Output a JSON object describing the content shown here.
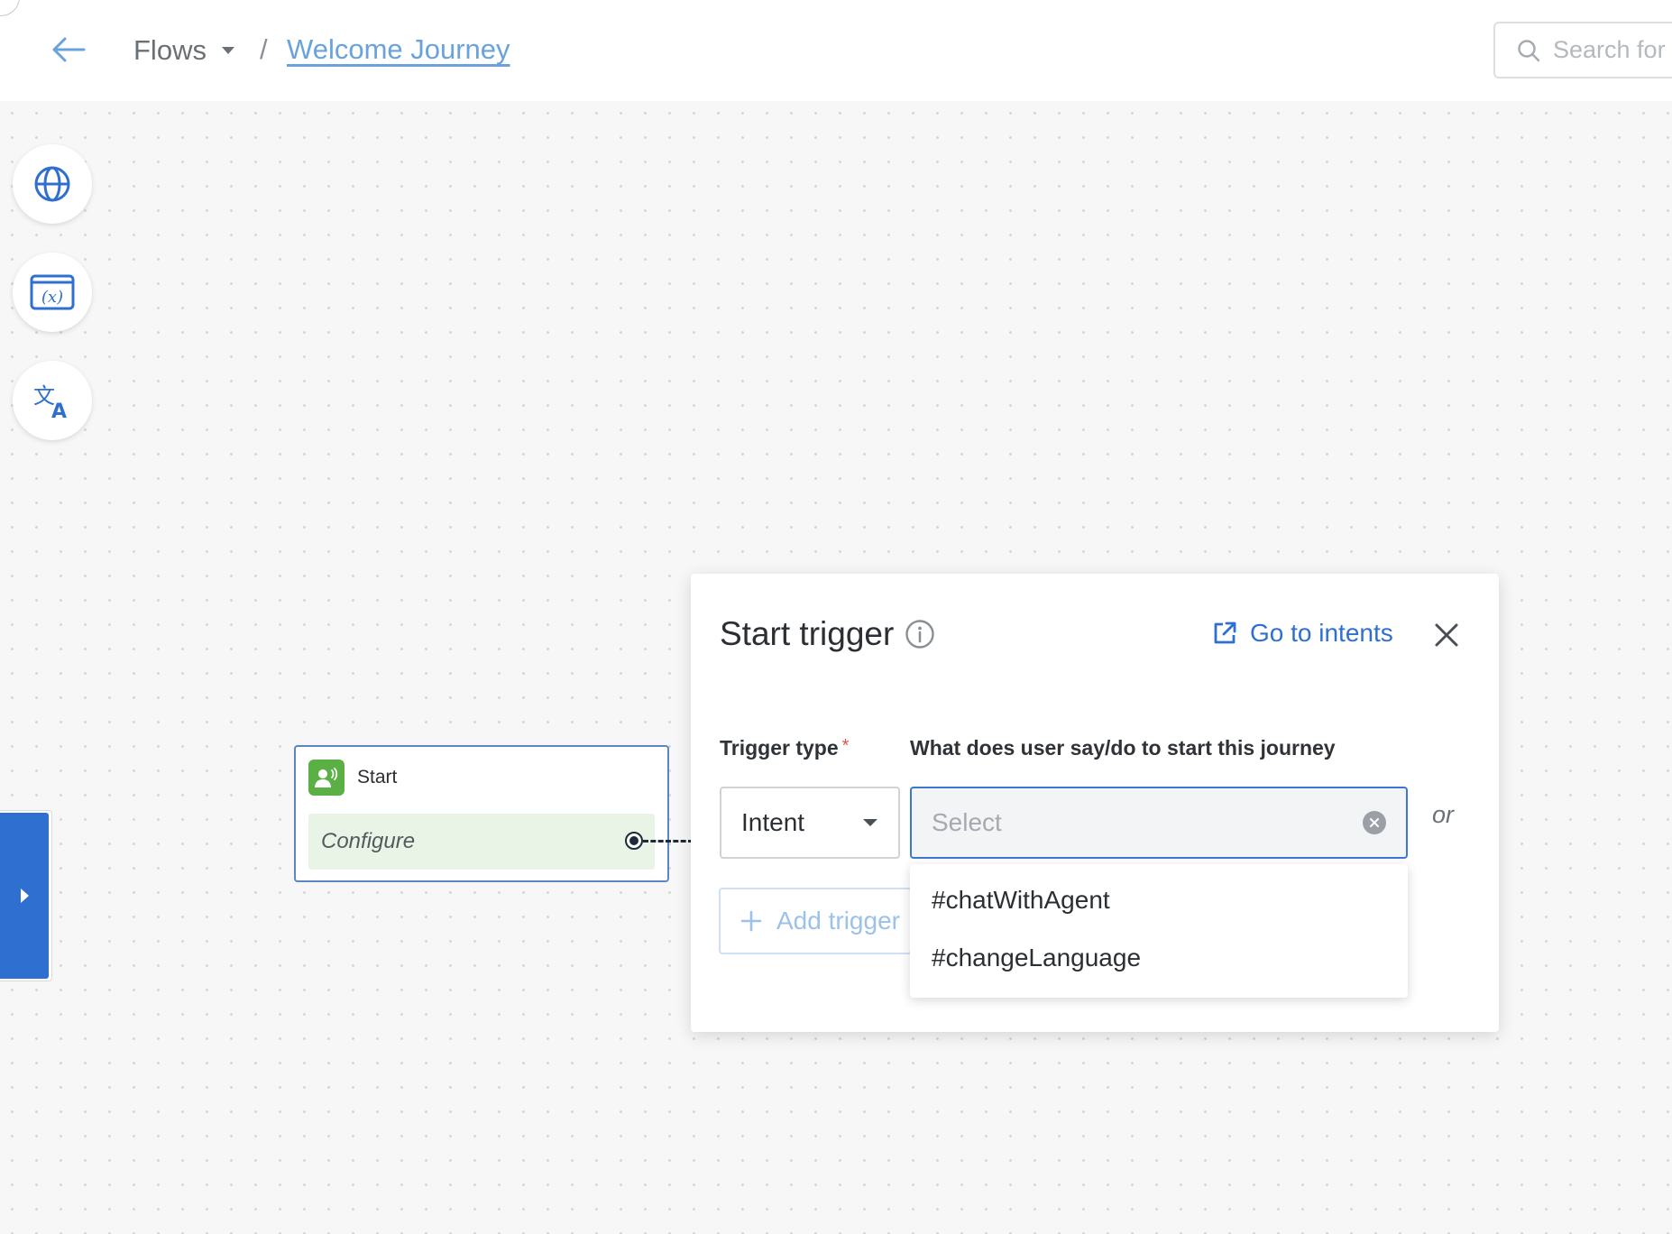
{
  "header": {
    "breadcrumb_root": "Flows",
    "breadcrumb_separator": "/",
    "breadcrumb_current": "Welcome Journey",
    "search_placeholder": "Search for"
  },
  "canvas": {
    "tools": [
      {
        "icon": "globe-icon"
      },
      {
        "icon": "variable-icon"
      },
      {
        "icon": "translate-icon"
      }
    ],
    "start_node": {
      "title": "Start",
      "configure_label": "Configure"
    }
  },
  "dialog": {
    "title": "Start trigger",
    "goto_label": "Go to intents",
    "trigger_type_label": "Trigger type",
    "required_marker": "*",
    "what_label": "What does user say/do to start this journey",
    "trigger_type_value": "Intent",
    "intent_placeholder": "Select",
    "or_label": "or",
    "add_trigger_label": "Add trigger",
    "options": [
      "#chatWithAgent",
      "#changeLanguage"
    ]
  },
  "colors": {
    "accent": "#2f6fd0",
    "link": "#6aa3dc",
    "start_icon": "#5bb045",
    "configure_bg": "#e9f4e6"
  }
}
